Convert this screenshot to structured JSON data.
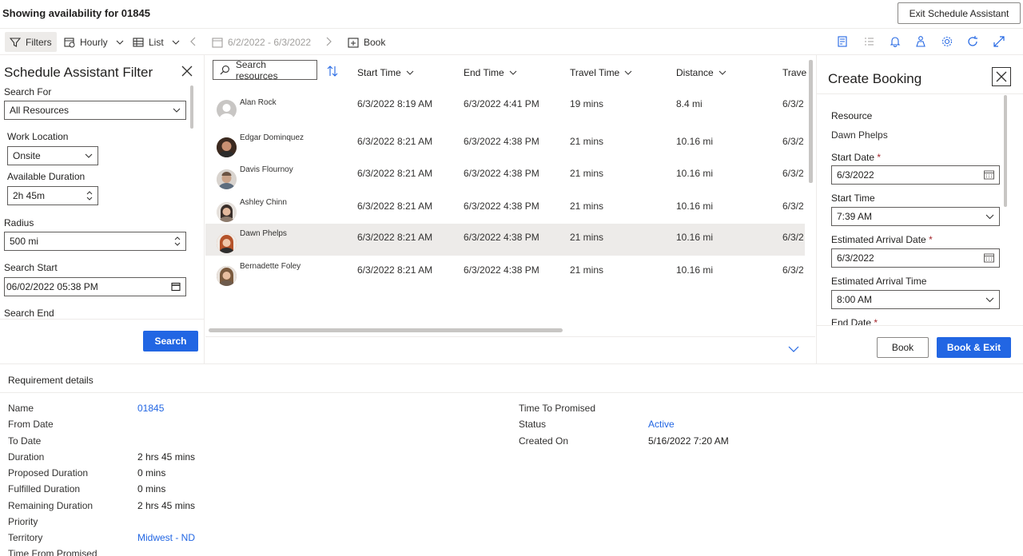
{
  "title": "Showing availability for 01845",
  "exit_button": "Exit Schedule Assistant",
  "toolbar": {
    "filters": "Filters",
    "hourly": "Hourly",
    "list": "List",
    "date_range": "6/2/2022 - 6/3/2022",
    "book": "Book"
  },
  "filter_panel": {
    "title": "Schedule Assistant Filter",
    "search_for_label": "Search For",
    "search_for_value": "All Resources",
    "work_location_label": "Work Location",
    "work_location_value": "Onsite",
    "available_duration_label": "Available Duration",
    "available_duration_value": "2h 45m",
    "radius_label": "Radius",
    "radius_value": "500 mi",
    "search_start_label": "Search Start",
    "search_start_value": "06/02/2022 05:38 PM",
    "search_end_label": "Search End",
    "search_button": "Search"
  },
  "grid": {
    "search_placeholder": "Search resources",
    "columns": [
      "Start Time",
      "End Time",
      "Travel Time",
      "Distance",
      "Trave"
    ],
    "rows": [
      {
        "name": "Alan Rock",
        "start": "6/3/2022 8:19 AM",
        "end": "6/3/2022 4:41 PM",
        "travel": "19 mins",
        "distance": "8.4 mi",
        "trave": "6/3/2"
      },
      {
        "name": "Edgar Dominquez",
        "start": "6/3/2022 8:21 AM",
        "end": "6/3/2022 4:38 PM",
        "travel": "21 mins",
        "distance": "10.16 mi",
        "trave": "6/3/2"
      },
      {
        "name": "Davis Flournoy",
        "start": "6/3/2022 8:21 AM",
        "end": "6/3/2022 4:38 PM",
        "travel": "21 mins",
        "distance": "10.16 mi",
        "trave": "6/3/2"
      },
      {
        "name": "Ashley Chinn",
        "start": "6/3/2022 8:21 AM",
        "end": "6/3/2022 4:38 PM",
        "travel": "21 mins",
        "distance": "10.16 mi",
        "trave": "6/3/2"
      },
      {
        "name": "Dawn Phelps",
        "start": "6/3/2022 8:21 AM",
        "end": "6/3/2022 4:38 PM",
        "travel": "21 mins",
        "distance": "10.16 mi",
        "trave": "6/3/2"
      },
      {
        "name": "Bernadette Foley",
        "start": "6/3/2022 8:21 AM",
        "end": "6/3/2022 4:38 PM",
        "travel": "21 mins",
        "distance": "10.16 mi",
        "trave": "6/3/2"
      }
    ]
  },
  "booking": {
    "title": "Create Booking",
    "resource_label": "Resource",
    "resource_value": "Dawn Phelps",
    "start_date_label": "Start Date",
    "start_date_value": "6/3/2022",
    "start_time_label": "Start Time",
    "start_time_value": "7:39 AM",
    "arrival_date_label": "Estimated Arrival Date",
    "arrival_date_value": "6/3/2022",
    "arrival_time_label": "Estimated Arrival Time",
    "arrival_time_value": "8:00 AM",
    "end_date_label": "End Date",
    "required_mark": "*",
    "book_button": "Book",
    "book_exit_button": "Book & Exit"
  },
  "requirement": {
    "title": "Requirement details",
    "left": [
      {
        "label": "Name",
        "value": "01845",
        "link": true
      },
      {
        "label": "From Date",
        "value": ""
      },
      {
        "label": "To Date",
        "value": ""
      },
      {
        "label": "Duration",
        "value": "2 hrs 45 mins"
      },
      {
        "label": "Proposed Duration",
        "value": "0 mins"
      },
      {
        "label": "Fulfilled Duration",
        "value": "0 mins"
      },
      {
        "label": "Remaining Duration",
        "value": "2 hrs 45 mins"
      },
      {
        "label": "Priority",
        "value": ""
      },
      {
        "label": "Territory",
        "value": "Midwest - ND",
        "link": true
      },
      {
        "label": "Time From Promised",
        "value": ""
      }
    ],
    "right": [
      {
        "label": "Time To Promised",
        "value": ""
      },
      {
        "label": "Status",
        "value": "Active",
        "link": true
      },
      {
        "label": "Created On",
        "value": "5/16/2022 7:20 AM"
      }
    ]
  },
  "colors": {
    "accent": "#2266e3",
    "selected_row": "#edebe9"
  }
}
